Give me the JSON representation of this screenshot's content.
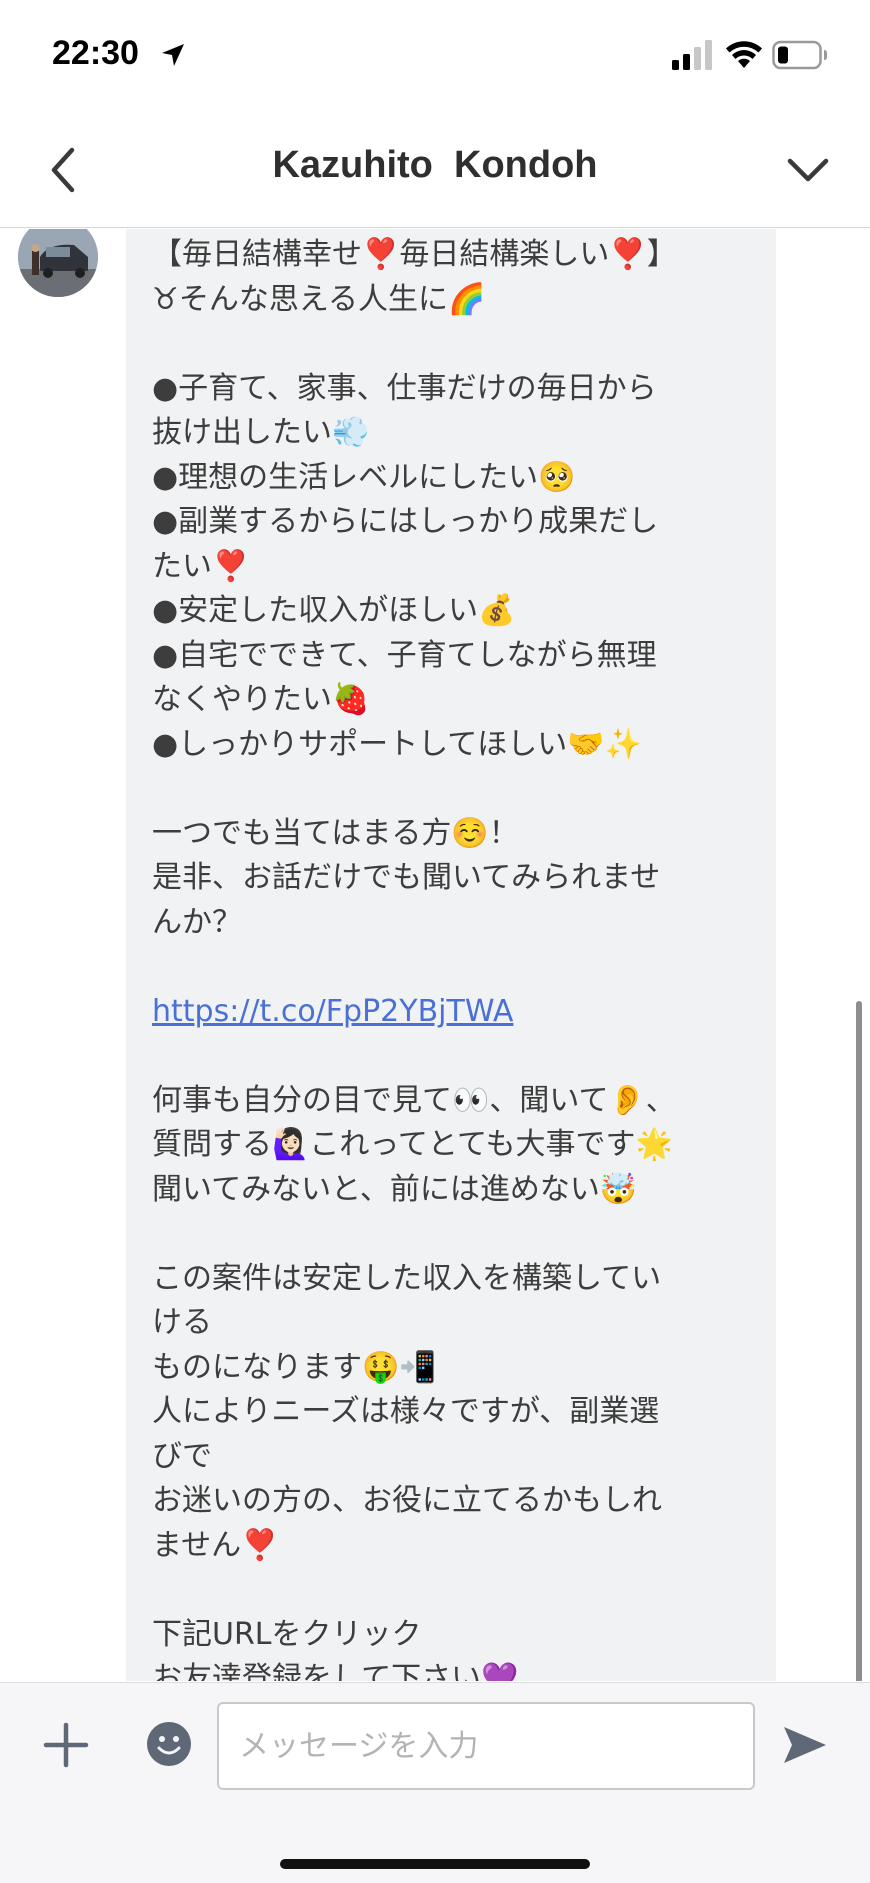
{
  "status_bar": {
    "time": "22:30",
    "icons": [
      "location-arrow-icon",
      "cell-signal-icon",
      "wifi-icon",
      "battery-icon"
    ]
  },
  "header": {
    "title": "Kazuhito  Kondoh",
    "back_icon": "chevron-left-icon",
    "menu_icon": "chevron-down-icon"
  },
  "message": {
    "lines": [
      "【毎日結構幸せ❣️毎日結構楽しい❣️】",
      "♉そんな思える人生に🌈",
      "",
      "●子育て、家事、仕事だけの毎日から",
      "抜け出したい💨",
      "●理想の生活レベルにしたい🥺",
      "●副業するからにはしっかり成果だし",
      "たい❣️",
      "●安定した収入がほしい💰",
      "●自宅でできて、子育てしながら無理",
      "なくやりたい🍓",
      "●しっかりサポートしてほしい🤝✨",
      "",
      "一つでも当てはまる方☺️！",
      "是非、お話だけでも聞いてみられませ",
      "んか？",
      "",
      "https://t.co/FpP2YBjTWA",
      "",
      "何事も自分の目で見て👀、聞いて👂、",
      "質問する🙋🏻‍♀️これってとても大事です🌟",
      "聞いてみないと、前には進めない🤯",
      "",
      "この案件は安定した収入を構築してい",
      "ける",
      "ものになります🤑📲",
      "人によりニーズは様々ですが、副業選",
      "びで",
      "お迷いの方の、お役に立てるかもしれ",
      "ません❣️",
      "",
      "下記URLをクリック",
      "お友達登録をして下さい💜"
    ],
    "link_index": 17
  },
  "composer": {
    "placeholder": "メッセージを入力",
    "plus_icon": "plus-icon",
    "emoji_icon": "smiley-icon",
    "send_icon": "send-icon"
  },
  "colors": {
    "bubble": "#f1f2f4",
    "link": "#4a6fd6",
    "composer_bg": "#f6f6f8",
    "icon": "#5f6877"
  }
}
